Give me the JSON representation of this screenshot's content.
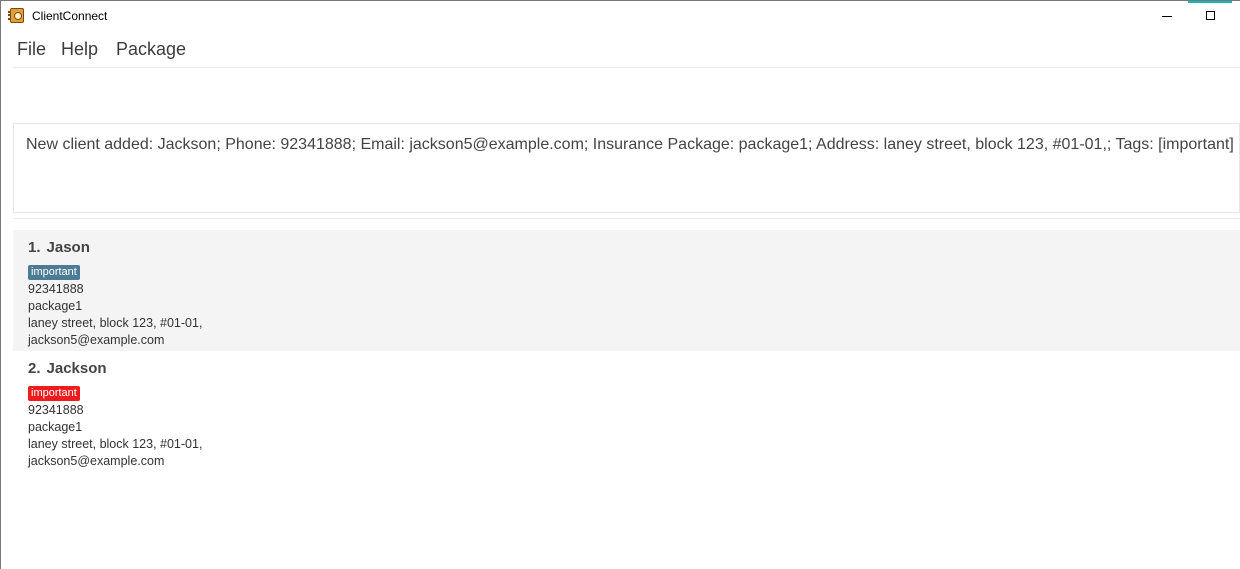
{
  "window": {
    "title": "ClientConnect",
    "accent_color": "#19b7b6"
  },
  "menu": {
    "items": [
      "File",
      "Help",
      "Package"
    ]
  },
  "command_box": {
    "value": "",
    "placeholder": ""
  },
  "result": {
    "text": "New client added: Jackson; Phone: 92341888; Email: jackson5@example.com; Insurance Package: package1; Address: laney street, block 123, #01-01,; Tags: [important]"
  },
  "clients": [
    {
      "index": "1.",
      "name": "Jason",
      "tag": "important",
      "tag_color": "#4c7c95",
      "phone": "92341888",
      "package": "package1",
      "address": "laney street, block 123, #01-01,",
      "email": "jackson5@example.com"
    },
    {
      "index": "2.",
      "name": "Jackson",
      "tag": "important",
      "tag_color": "#ee1c1c",
      "phone": "92341888",
      "package": "package1",
      "address": "laney street, block 123, #01-01,",
      "email": "jackson5@example.com"
    }
  ]
}
